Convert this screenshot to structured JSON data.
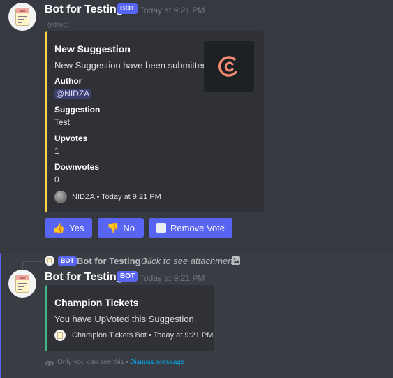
{
  "msg1": {
    "username": "Bot for Testing +",
    "bot_tag": "BOT",
    "timestamp": "Today at 9:21 PM",
    "edited": "(edited)",
    "embed": {
      "accent": "#fcd44a",
      "title": "New Suggestion",
      "description": "New Suggestion have been submitted.",
      "fields": [
        {
          "name": "Author",
          "value": "@NIDZA"
        },
        {
          "name": "Suggestion",
          "value": "Test"
        },
        {
          "name": "Upvotes",
          "value": "1"
        },
        {
          "name": "Downvotes",
          "value": "0"
        }
      ],
      "footer": "NIDZA • Today at 9:21 PM",
      "thumbnail_icon": "c-logo-icon"
    },
    "buttons": [
      {
        "label": "Yes",
        "icon": "thumbs-up-icon"
      },
      {
        "label": "No",
        "icon": "thumbs-down-icon"
      },
      {
        "label": "Remove Vote",
        "icon": "white-square-icon"
      }
    ]
  },
  "msg2": {
    "reply": {
      "bot_tag": "BOT",
      "username": "Bot for Testing +",
      "text": "Click to see attachment",
      "icon": "image-icon"
    },
    "username": "Bot for Testing +",
    "bot_tag": "BOT",
    "timestamp": "Today at 9:21 PM",
    "embed": {
      "accent": "#43b581",
      "title": "Champion Tickets",
      "description": "You have UpVoted this Suggestion.",
      "footer": "Champion Tickets Bot • Today at 9:21 PM"
    },
    "ephemeral": {
      "text": "Only you can see this •",
      "dismiss": "Dismiss message",
      "icon": "eye-icon"
    }
  },
  "colors": {
    "background": "#36393f",
    "embed_bg": "#2f3136",
    "blurple": "#5865f2",
    "link": "#00aff4"
  }
}
